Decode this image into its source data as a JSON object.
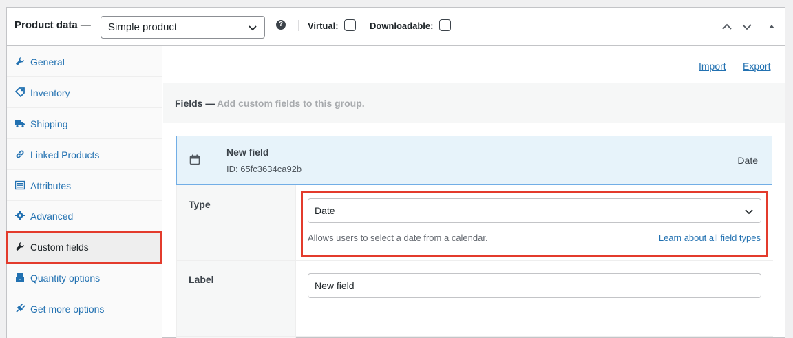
{
  "header": {
    "title": "Product data —",
    "product_type": "Simple product",
    "help_icon": "?",
    "virtual_label": "Virtual:",
    "downloadable_label": "Downloadable:"
  },
  "sidebar": {
    "items": [
      {
        "label": "General",
        "icon": "wrench-icon"
      },
      {
        "label": "Inventory",
        "icon": "tag-icon"
      },
      {
        "label": "Shipping",
        "icon": "truck-icon"
      },
      {
        "label": "Linked Products",
        "icon": "link-icon"
      },
      {
        "label": "Attributes",
        "icon": "list-icon"
      },
      {
        "label": "Advanced",
        "icon": "gear-icon"
      },
      {
        "label": "Custom fields",
        "icon": "wrench-icon",
        "active": true
      },
      {
        "label": "Quantity options",
        "icon": "stack-icon"
      },
      {
        "label": "Get more options",
        "icon": "plugin-icon"
      }
    ]
  },
  "toolbar": {
    "import_label": "Import",
    "export_label": "Export"
  },
  "fields": {
    "title": "Fields —",
    "description": "Add custom fields to this group."
  },
  "field": {
    "name": "New field",
    "id": "ID: 65fc3634ca92b",
    "type": "Date",
    "type_label": "Type",
    "type_value": "Date",
    "type_hint": "Allows users to select a date from a calendar.",
    "type_link": "Learn about all field types",
    "label_label": "Label",
    "label_value": "New field"
  },
  "colors": {
    "link": "#2271b1",
    "highlight": "#e33b2c",
    "field_header_bg": "#e7f3fa"
  }
}
